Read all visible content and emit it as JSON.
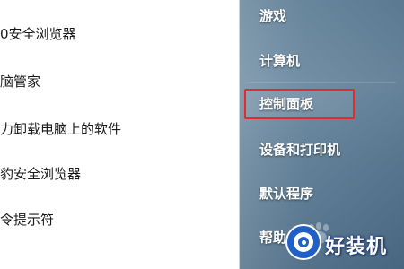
{
  "program_list": {
    "items": [
      {
        "label": "0安全浏览器"
      },
      {
        "label": "脑管家"
      },
      {
        "label": "力卸载电脑上的软件"
      },
      {
        "label": "豹安全浏览器"
      },
      {
        "label": "令提示符"
      }
    ]
  },
  "right_pane": {
    "items": [
      {
        "label": "游戏"
      },
      {
        "label": "计算机"
      },
      {
        "label": "控制面板"
      },
      {
        "label": "设备和打印机"
      },
      {
        "label": "默认程序"
      },
      {
        "label": "帮助"
      }
    ],
    "highlight_color": "#e62a2a"
  },
  "watermark": {
    "text": "好装机",
    "icon": "eye-icon"
  }
}
